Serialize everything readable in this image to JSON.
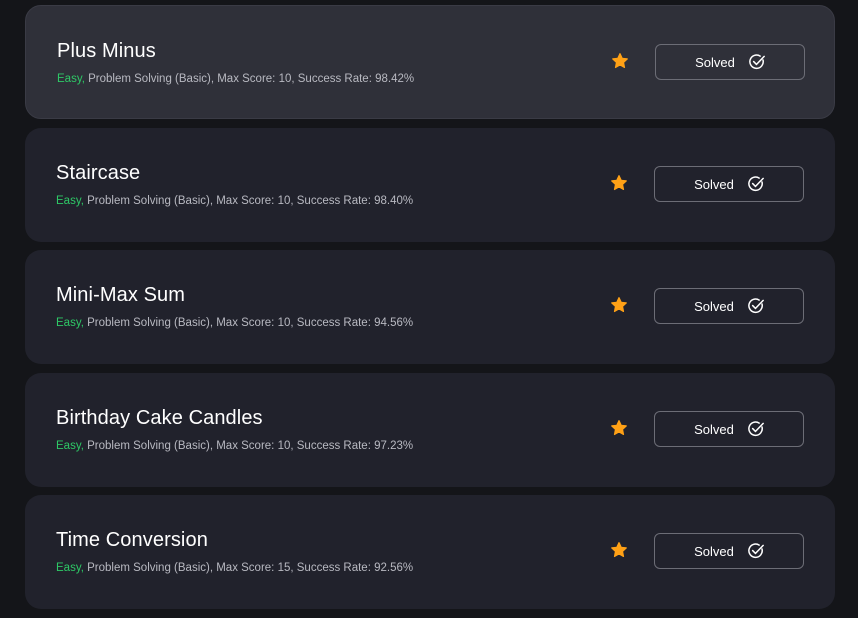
{
  "challenges": [
    {
      "title": "Plus Minus",
      "difficulty": "Easy,",
      "details": " Problem Solving (Basic), Max Score: 10, Success Rate: 98.42%",
      "status_label": "Solved"
    },
    {
      "title": "Staircase",
      "difficulty": "Easy,",
      "details": " Problem Solving (Basic), Max Score: 10, Success Rate: 98.40%",
      "status_label": "Solved"
    },
    {
      "title": "Mini-Max Sum",
      "difficulty": "Easy,",
      "details": " Problem Solving (Basic), Max Score: 10, Success Rate: 94.56%",
      "status_label": "Solved"
    },
    {
      "title": "Birthday Cake Candles",
      "difficulty": "Easy,",
      "details": " Problem Solving (Basic), Max Score: 10, Success Rate: 97.23%",
      "status_label": "Solved"
    },
    {
      "title": "Time Conversion",
      "difficulty": "Easy,",
      "details": " Problem Solving (Basic), Max Score: 15, Success Rate: 92.56%",
      "status_label": "Solved"
    }
  ],
  "icons": {
    "star": "star-icon",
    "solved": "check-circle-icon"
  },
  "colors": {
    "difficulty_easy": "#2ec866",
    "star": "#ffa116",
    "card_background": "#21222c",
    "card_hover_background": "#2f3039",
    "page_background": "#141519"
  }
}
